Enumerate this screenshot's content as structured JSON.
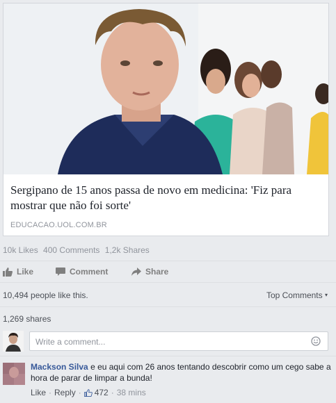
{
  "article": {
    "headline": "Sergipano de 15 anos passa de novo em medicina: 'Fiz para mostrar que não foi sorte'",
    "source": "EDUCACAO.UOL.COM.BR"
  },
  "stats": {
    "likes": "10k Likes",
    "comments": "400 Comments",
    "shares": "1,2k Shares"
  },
  "actions": {
    "like": "Like",
    "comment": "Comment",
    "share": "Share"
  },
  "reactions": {
    "likes_text": "10,494 people like this.",
    "top_comments": "Top Comments",
    "shares_text": "1,269 shares"
  },
  "composer": {
    "placeholder": "Write a comment..."
  },
  "comment": {
    "author": "Mackson Silva",
    "text": "e eu aqui com 26 anos tentando descobrir como um cego sabe a hora de parar de limpar a bunda!",
    "like": "Like",
    "reply": "Reply",
    "like_count": "472",
    "time": "38 mins"
  },
  "colors": {
    "link_blue": "#365899",
    "muted": "#90949c",
    "background": "#e9ebee"
  },
  "icons": [
    "thumbs-up-icon",
    "comment-bubble-icon",
    "share-arrow-icon",
    "emoji-icon",
    "chevron-down-icon"
  ]
}
